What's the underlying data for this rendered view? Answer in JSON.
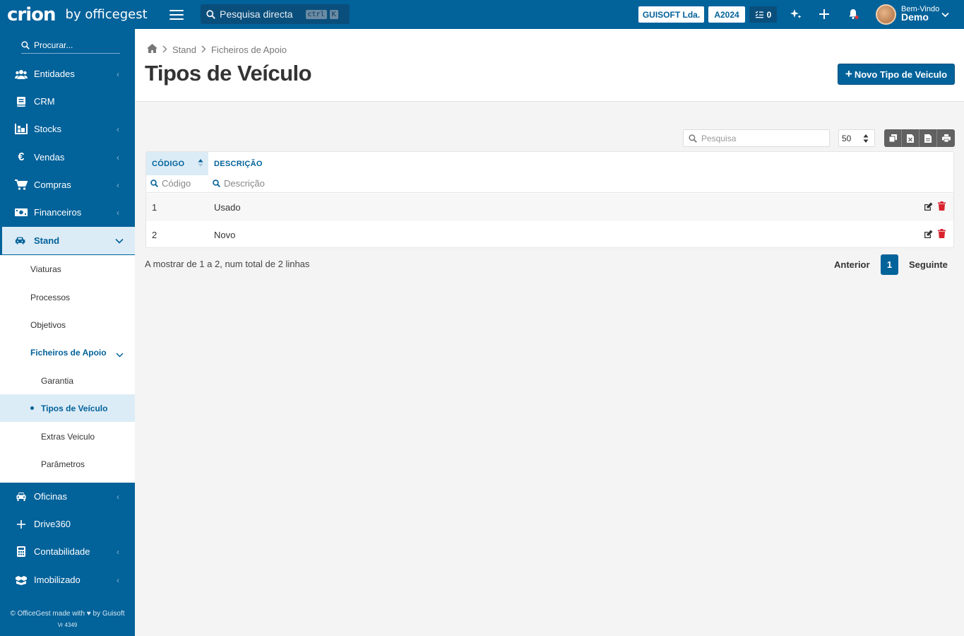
{
  "topbar": {
    "logo": "crion",
    "logo_by": "by officegest",
    "search_placeholder": "Pesquisa directa",
    "kbd_ctrl": "ctrl",
    "kbd_k": "K",
    "company": "GUISOFT Lda.",
    "year": "A2024",
    "tasks_count": "0",
    "welcome": "Bem-Vindo",
    "user": "Demo"
  },
  "sidebar": {
    "search_placeholder": "Procurar...",
    "items": [
      {
        "label": "Entidades",
        "icon": "users-icon"
      },
      {
        "label": "CRM",
        "icon": "book-icon"
      },
      {
        "label": "Stocks",
        "icon": "warehouse-icon"
      },
      {
        "label": "Vendas",
        "icon": "euro-icon"
      },
      {
        "label": "Compras",
        "icon": "cart-icon"
      },
      {
        "label": "Financeiros",
        "icon": "money-icon"
      },
      {
        "label": "Stand",
        "icon": "car-icon"
      },
      {
        "label": "Oficinas",
        "icon": "car-front-icon"
      },
      {
        "label": "Drive360",
        "icon": "plus-icon"
      },
      {
        "label": "Contabilidade",
        "icon": "calculator-icon"
      },
      {
        "label": "Imobilizado",
        "icon": "boxes-icon"
      }
    ],
    "stand_sub": [
      "Viaturas",
      "Processos",
      "Objetivos",
      "Ficheiros de Apoio"
    ],
    "apoio_sub": [
      "Garantia",
      "Tipos de Veículo",
      "Extras Veiculo",
      "Parâmetros"
    ],
    "footer": "© OfficeGest made with ♥ by Guisoft",
    "version": "Vr 4349"
  },
  "breadcrumb": {
    "level1": "Stand",
    "level2": "Ficheiros de Apoio"
  },
  "page": {
    "title": "Tipos de Veículo",
    "new_button": "Novo Tipo de Veiculo"
  },
  "toolbar": {
    "search_placeholder": "Pesquisa",
    "page_size": "50"
  },
  "table": {
    "columns": [
      "CÓDIGO",
      "DESCRIÇÃO"
    ],
    "filters": [
      "Código",
      "Descrição"
    ],
    "rows": [
      {
        "codigo": "1",
        "descricao": "Usado"
      },
      {
        "codigo": "2",
        "descricao": "Novo"
      }
    ]
  },
  "footer": {
    "info": "A mostrar de 1 a 2, num total de 2 linhas",
    "prev": "Anterior",
    "page": "1",
    "next": "Seguinte"
  },
  "colors": {
    "primary": "#02629a",
    "active_bg": "#dcecf6",
    "delete": "#d9232d"
  }
}
